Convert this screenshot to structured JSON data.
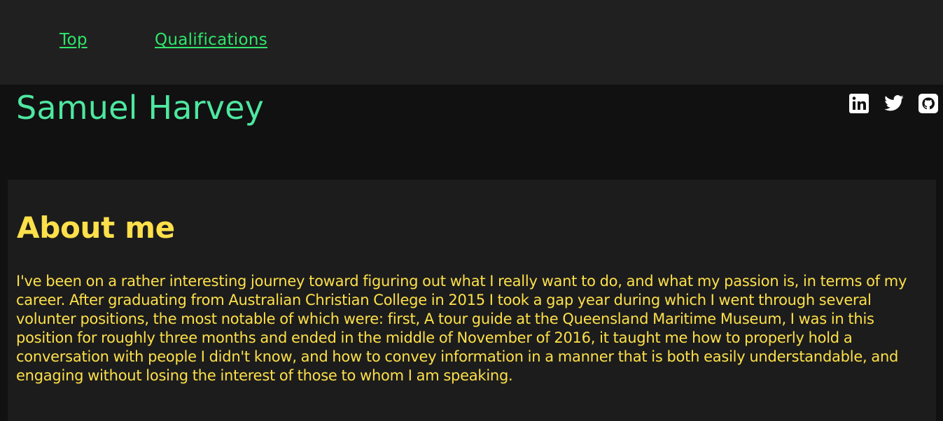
{
  "nav": {
    "links": [
      {
        "label": "Top"
      },
      {
        "label": "Qualifications"
      }
    ]
  },
  "header": {
    "name": "Samuel Harvey",
    "social": [
      {
        "icon": "linkedin-icon"
      },
      {
        "icon": "twitter-icon"
      },
      {
        "icon": "github-icon"
      }
    ]
  },
  "about": {
    "heading": "About me",
    "body": "I've been on a rather interesting journey toward figuring out what I really want to do, and what my passion is, in terms of my career. After graduating from Australian Christian College in 2015 I took a gap year during which I went through several volunter positions, the most notable of which were: first, A tour guide at the Queensland Maritime Museum, I was in this position for roughly three months and ended in the middle of November of 2016, it taught me how to properly hold a conversation with people I didn't know, and how to convey information in a manner that is both easily understandable, and engaging without losing the interest of those to whom I am speaking."
  },
  "colors": {
    "nav_link": "#2ee66a",
    "name": "#4ee7a0",
    "accent_text": "#fde04a",
    "nav_bg": "#202020",
    "page_bg": "#111111",
    "content_bg": "#1c1c1c"
  }
}
